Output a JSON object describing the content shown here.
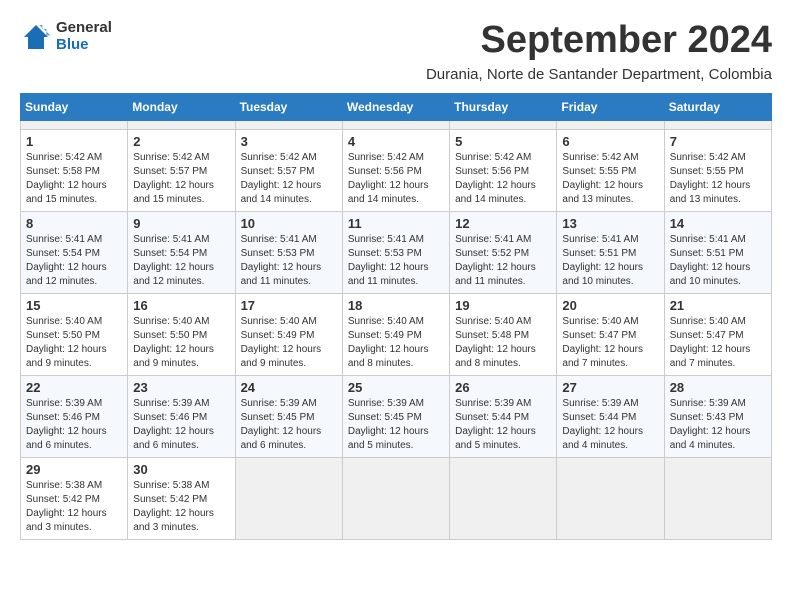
{
  "header": {
    "logo": {
      "general": "General",
      "blue": "Blue"
    },
    "title": "September 2024",
    "subtitle": "Durania, Norte de Santander Department, Colombia"
  },
  "calendar": {
    "weekdays": [
      "Sunday",
      "Monday",
      "Tuesday",
      "Wednesday",
      "Thursday",
      "Friday",
      "Saturday"
    ],
    "weeks": [
      [
        {
          "day": null
        },
        {
          "day": null
        },
        {
          "day": null
        },
        {
          "day": null
        },
        {
          "day": null
        },
        {
          "day": null
        },
        {
          "day": null
        }
      ],
      [
        {
          "day": "1",
          "sunrise": "Sunrise: 5:42 AM",
          "sunset": "Sunset: 5:58 PM",
          "daylight": "Daylight: 12 hours and 15 minutes."
        },
        {
          "day": "2",
          "sunrise": "Sunrise: 5:42 AM",
          "sunset": "Sunset: 5:57 PM",
          "daylight": "Daylight: 12 hours and 15 minutes."
        },
        {
          "day": "3",
          "sunrise": "Sunrise: 5:42 AM",
          "sunset": "Sunset: 5:57 PM",
          "daylight": "Daylight: 12 hours and 14 minutes."
        },
        {
          "day": "4",
          "sunrise": "Sunrise: 5:42 AM",
          "sunset": "Sunset: 5:56 PM",
          "daylight": "Daylight: 12 hours and 14 minutes."
        },
        {
          "day": "5",
          "sunrise": "Sunrise: 5:42 AM",
          "sunset": "Sunset: 5:56 PM",
          "daylight": "Daylight: 12 hours and 14 minutes."
        },
        {
          "day": "6",
          "sunrise": "Sunrise: 5:42 AM",
          "sunset": "Sunset: 5:55 PM",
          "daylight": "Daylight: 12 hours and 13 minutes."
        },
        {
          "day": "7",
          "sunrise": "Sunrise: 5:42 AM",
          "sunset": "Sunset: 5:55 PM",
          "daylight": "Daylight: 12 hours and 13 minutes."
        }
      ],
      [
        {
          "day": "8",
          "sunrise": "Sunrise: 5:41 AM",
          "sunset": "Sunset: 5:54 PM",
          "daylight": "Daylight: 12 hours and 12 minutes."
        },
        {
          "day": "9",
          "sunrise": "Sunrise: 5:41 AM",
          "sunset": "Sunset: 5:54 PM",
          "daylight": "Daylight: 12 hours and 12 minutes."
        },
        {
          "day": "10",
          "sunrise": "Sunrise: 5:41 AM",
          "sunset": "Sunset: 5:53 PM",
          "daylight": "Daylight: 12 hours and 11 minutes."
        },
        {
          "day": "11",
          "sunrise": "Sunrise: 5:41 AM",
          "sunset": "Sunset: 5:53 PM",
          "daylight": "Daylight: 12 hours and 11 minutes."
        },
        {
          "day": "12",
          "sunrise": "Sunrise: 5:41 AM",
          "sunset": "Sunset: 5:52 PM",
          "daylight": "Daylight: 12 hours and 11 minutes."
        },
        {
          "day": "13",
          "sunrise": "Sunrise: 5:41 AM",
          "sunset": "Sunset: 5:51 PM",
          "daylight": "Daylight: 12 hours and 10 minutes."
        },
        {
          "day": "14",
          "sunrise": "Sunrise: 5:41 AM",
          "sunset": "Sunset: 5:51 PM",
          "daylight": "Daylight: 12 hours and 10 minutes."
        }
      ],
      [
        {
          "day": "15",
          "sunrise": "Sunrise: 5:40 AM",
          "sunset": "Sunset: 5:50 PM",
          "daylight": "Daylight: 12 hours and 9 minutes."
        },
        {
          "day": "16",
          "sunrise": "Sunrise: 5:40 AM",
          "sunset": "Sunset: 5:50 PM",
          "daylight": "Daylight: 12 hours and 9 minutes."
        },
        {
          "day": "17",
          "sunrise": "Sunrise: 5:40 AM",
          "sunset": "Sunset: 5:49 PM",
          "daylight": "Daylight: 12 hours and 9 minutes."
        },
        {
          "day": "18",
          "sunrise": "Sunrise: 5:40 AM",
          "sunset": "Sunset: 5:49 PM",
          "daylight": "Daylight: 12 hours and 8 minutes."
        },
        {
          "day": "19",
          "sunrise": "Sunrise: 5:40 AM",
          "sunset": "Sunset: 5:48 PM",
          "daylight": "Daylight: 12 hours and 8 minutes."
        },
        {
          "day": "20",
          "sunrise": "Sunrise: 5:40 AM",
          "sunset": "Sunset: 5:47 PM",
          "daylight": "Daylight: 12 hours and 7 minutes."
        },
        {
          "day": "21",
          "sunrise": "Sunrise: 5:40 AM",
          "sunset": "Sunset: 5:47 PM",
          "daylight": "Daylight: 12 hours and 7 minutes."
        }
      ],
      [
        {
          "day": "22",
          "sunrise": "Sunrise: 5:39 AM",
          "sunset": "Sunset: 5:46 PM",
          "daylight": "Daylight: 12 hours and 6 minutes."
        },
        {
          "day": "23",
          "sunrise": "Sunrise: 5:39 AM",
          "sunset": "Sunset: 5:46 PM",
          "daylight": "Daylight: 12 hours and 6 minutes."
        },
        {
          "day": "24",
          "sunrise": "Sunrise: 5:39 AM",
          "sunset": "Sunset: 5:45 PM",
          "daylight": "Daylight: 12 hours and 6 minutes."
        },
        {
          "day": "25",
          "sunrise": "Sunrise: 5:39 AM",
          "sunset": "Sunset: 5:45 PM",
          "daylight": "Daylight: 12 hours and 5 minutes."
        },
        {
          "day": "26",
          "sunrise": "Sunrise: 5:39 AM",
          "sunset": "Sunset: 5:44 PM",
          "daylight": "Daylight: 12 hours and 5 minutes."
        },
        {
          "day": "27",
          "sunrise": "Sunrise: 5:39 AM",
          "sunset": "Sunset: 5:44 PM",
          "daylight": "Daylight: 12 hours and 4 minutes."
        },
        {
          "day": "28",
          "sunrise": "Sunrise: 5:39 AM",
          "sunset": "Sunset: 5:43 PM",
          "daylight": "Daylight: 12 hours and 4 minutes."
        }
      ],
      [
        {
          "day": "29",
          "sunrise": "Sunrise: 5:38 AM",
          "sunset": "Sunset: 5:42 PM",
          "daylight": "Daylight: 12 hours and 3 minutes."
        },
        {
          "day": "30",
          "sunrise": "Sunrise: 5:38 AM",
          "sunset": "Sunset: 5:42 PM",
          "daylight": "Daylight: 12 hours and 3 minutes."
        },
        {
          "day": null
        },
        {
          "day": null
        },
        {
          "day": null
        },
        {
          "day": null
        },
        {
          "day": null
        }
      ]
    ]
  }
}
